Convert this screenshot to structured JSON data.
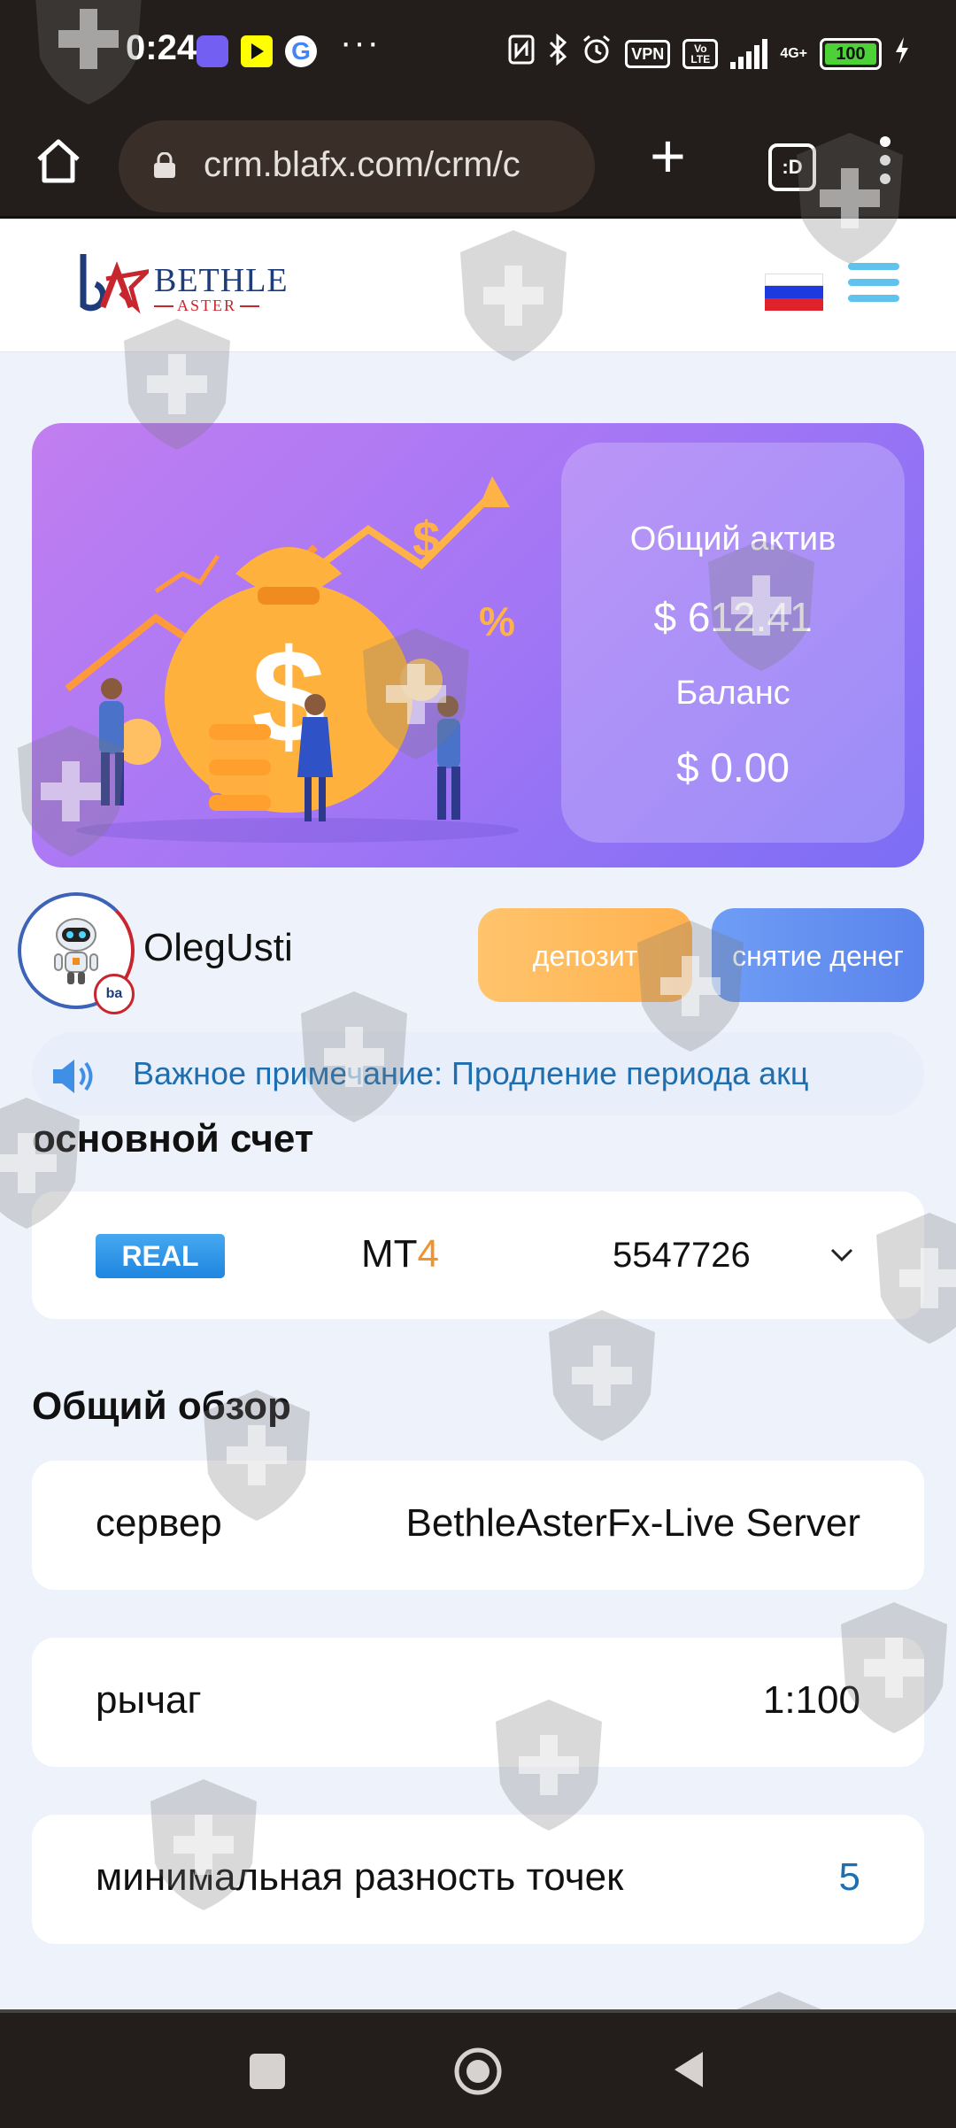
{
  "status_bar": {
    "time": "0:24",
    "google_glyph": "G",
    "more": "···",
    "vpn": "VPN",
    "volte": "Vo LTE",
    "network": "4G+",
    "battery": "100",
    "icons": [
      "viber-icon",
      "youtube-icon",
      "google-icon",
      "nfc-icon",
      "bluetooth-icon",
      "alarm-icon",
      "vpn-icon",
      "volte-icon",
      "signal-icon",
      "battery-icon",
      "charging-icon"
    ]
  },
  "browser": {
    "url": "crm.blafx.com/crm/c",
    "tab_count_label": ":D"
  },
  "header": {
    "logo_name": "BETHLE",
    "logo_sub": "ASTER",
    "logo_mark": "ba"
  },
  "hero": {
    "total_asset_label": "Общий актив",
    "total_asset_value": "$ 612.41",
    "balance_label": "Баланс",
    "balance_value": "$ 0.00"
  },
  "user": {
    "name": "OlegUsti",
    "badge": "ba"
  },
  "actions": {
    "deposit": "депозит",
    "withdraw": "снятие денег"
  },
  "notice": {
    "text": "Важное примечание: Продление периода акц"
  },
  "account": {
    "section_title": "основной счет",
    "type": "REAL",
    "platform_prefix": "MT",
    "platform_version": "4",
    "number": "5547726"
  },
  "overview": {
    "section_title": "Общий обзор",
    "rows": [
      {
        "label": "сервер",
        "value": "BethleAsterFx-Live Server"
      },
      {
        "label": "рычаг",
        "value": "1:100"
      },
      {
        "label": "минимальная разность точек",
        "value": "5"
      }
    ]
  },
  "colors": {
    "accent_blue": "#1f6fb0",
    "deposit": "#ffb14f",
    "withdraw": "#5b84ec",
    "platform_version": "#f0932b",
    "hero_start": "#c17ef0",
    "hero_end": "#7c6df5"
  }
}
